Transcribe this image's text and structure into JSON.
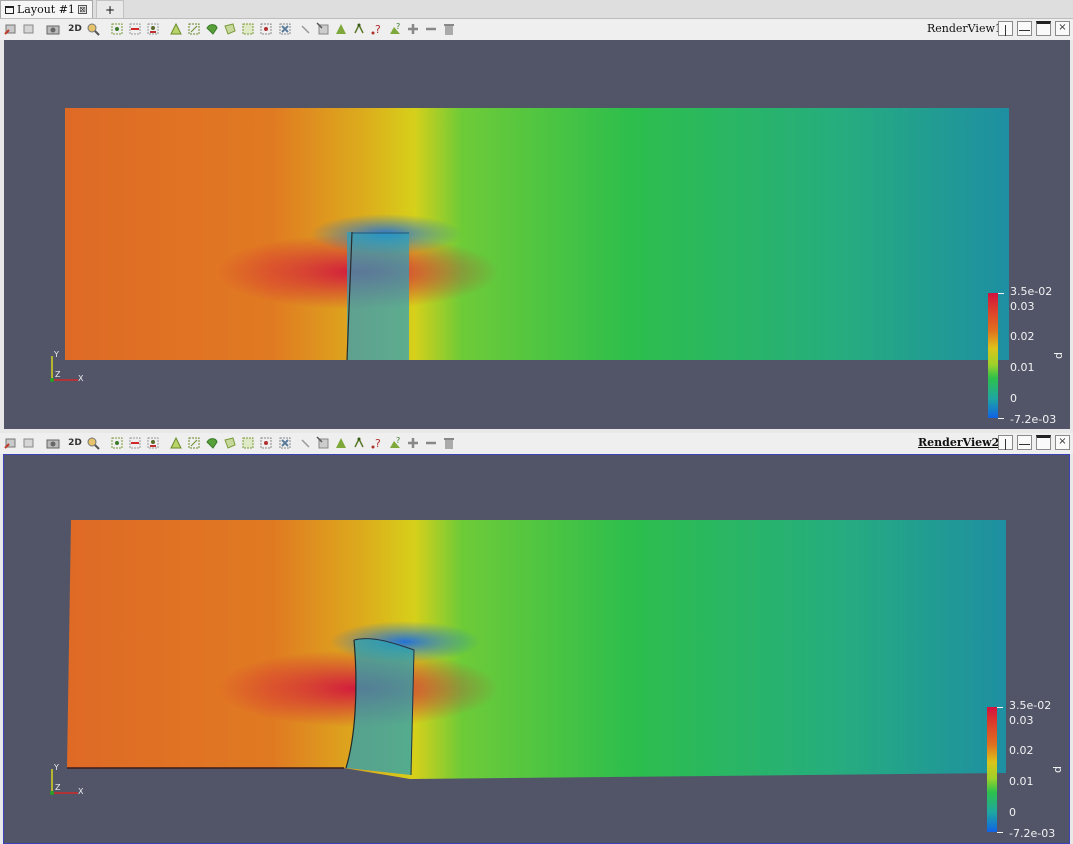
{
  "layout_tab": {
    "label": "Layout #1",
    "close": "⊠",
    "add_label": "+"
  },
  "views": [
    {
      "name": "RenderView1",
      "active": false,
      "colorbar": {
        "title": "p",
        "max_label": "3.5e-02",
        "min_label": "-7.2e-03",
        "ticks": [
          "0.03",
          "0.02",
          "0.01",
          "0"
        ]
      },
      "axes": {
        "x": "X",
        "y": "Y",
        "z": "Z"
      }
    },
    {
      "name": "RenderView2",
      "active": true,
      "colorbar": {
        "title": "p",
        "max_label": "3.5e-02",
        "min_label": "-7.2e-03",
        "ticks": [
          "0.03",
          "0.02",
          "0.01",
          "0"
        ]
      },
      "axes": {
        "x": "X",
        "y": "Y",
        "z": "Z"
      }
    }
  ],
  "toolbar_buttons": [
    "reset-camera",
    "zoom-closest",
    "capture-screenshot",
    "2d-mode",
    "zoom-to-box",
    "interactive-select",
    "select-cells",
    "select-points",
    "select-surface-cells",
    "select-surface-points",
    "select-frustum-cells",
    "select-frustum-points",
    "select-block",
    "select-polygon",
    "select-cells-on",
    "select-points-on",
    "hover-points",
    "grow-selection",
    "shrink-selection",
    "clear-selection"
  ],
  "toolbar_2d_label": "2D",
  "colors": {
    "background": "#525568",
    "active_border": "#3a43b8"
  }
}
